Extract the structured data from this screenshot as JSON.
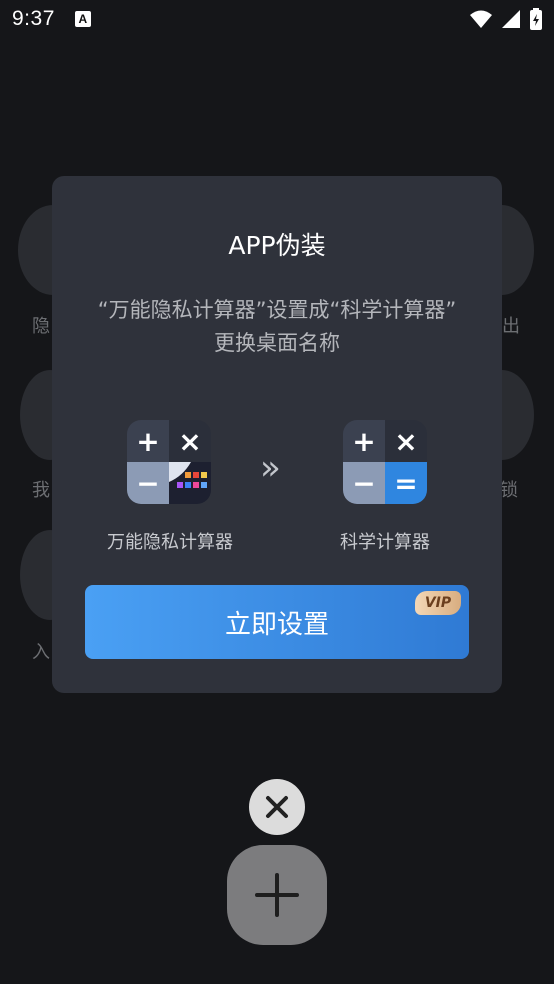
{
  "status_bar": {
    "time": "9:37",
    "notification_icon": "A"
  },
  "background": {
    "left_labels": [
      "隐",
      "我",
      "入"
    ],
    "right_labels": [
      "出",
      "锁"
    ]
  },
  "dialog": {
    "title": "APP伪装",
    "description_line1": "“万能隐私计算器”设置成“科学计算器”",
    "description_line2": "更换桌面名称",
    "from_label": "万能隐私计算器",
    "to_label": "科学计算器",
    "arrow_glyph": "»",
    "button_label": "立即设置",
    "vip_badge": "VIP",
    "calc_symbols": {
      "plus": "+",
      "times": "×",
      "minus": "−",
      "equals": "="
    }
  },
  "colors": {
    "accent_blue": "#3a8ce6",
    "dialog_bg": "#2f323b",
    "vip_gold": "#e6c199"
  }
}
